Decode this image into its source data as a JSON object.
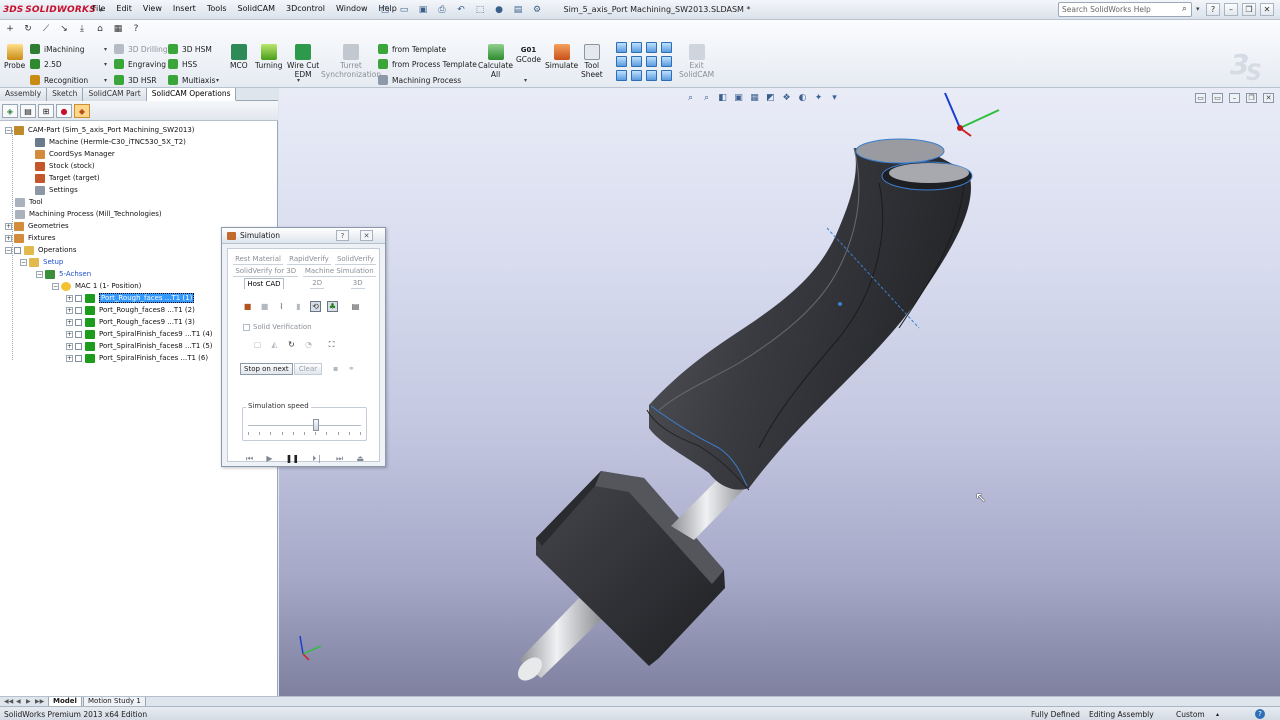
{
  "app": {
    "logo": "SOLIDWORKS",
    "title": "Sim_5_axis_Port Machining_SW2013.SLDASM *"
  },
  "menus": [
    "File",
    "Edit",
    "View",
    "Insert",
    "Tools",
    "SolidCAM",
    "3Dcontrol",
    "Window",
    "Help"
  ],
  "help_search": {
    "placeholder": "Search SolidWorks Help"
  },
  "commands": {
    "probe": "Probe",
    "imachining": "iMachining",
    "drilling_3d": "3D Drilling",
    "hsm_3d": "3D HSM",
    "d25": "2.5D",
    "engraving": "Engraving",
    "hss": "HSS",
    "recognition": "Recognition",
    "hsr_3d": "3D HSR",
    "multiaxis": "Multiaxis",
    "mco": "MCO",
    "turning": "Turning",
    "wire_edm": [
      "Wire Cut",
      "EDM"
    ],
    "turret_sync": [
      "Turret",
      "Synchronization"
    ],
    "from_template": "from Template",
    "from_process_template": "from Process Template",
    "machining_process": "Machining Process",
    "calculate_all": [
      "Calculate",
      "All"
    ],
    "gcode_top": "G01",
    "gcode": "GCode",
    "simulate": "Simulate",
    "tool_sheet": [
      "Tool",
      "Sheet"
    ],
    "exit_solidcam": [
      "Exit",
      "SolidCAM"
    ]
  },
  "tabs": [
    {
      "label": "Assembly",
      "active": false
    },
    {
      "label": "Sketch",
      "active": false
    },
    {
      "label": "SolidCAM Part",
      "active": false
    },
    {
      "label": "SolidCAM Operations",
      "active": true
    }
  ],
  "tree": {
    "root": "CAM-Part (Sim_5_axis_Port Machining_SW2013)",
    "machine": "Machine (Hermle-C30_iTNC530_5X_T2)",
    "coordsys": "CoordSys Manager",
    "stock": "Stock (stock)",
    "target": "Target (target)",
    "settings": "Settings",
    "tool": "Tool",
    "machining_process": "Machining Process (Mill_Technologies)",
    "geometries": "Geometries",
    "fixtures": "Fixtures",
    "operations": "Operations",
    "setup": "Setup",
    "achsen": "5-Achsen",
    "mac": "MAC 1 (1- Position)",
    "ops": [
      "Port_Rough_faces ...T1 (1)",
      "Port_Rough_faces8 ...T1 (2)",
      "Port_Rough_faces9 ...T1 (3)",
      "Port_SpiralFinish_faces9 ...T1 (4)",
      "Port_SpiralFinish_faces8 ...T1 (5)",
      "Port_SpiralFinish_faces ...T1 (6)"
    ]
  },
  "simulation": {
    "title": "Simulation",
    "tabs_row1": [
      "Rest Material",
      "RapidVerify",
      "SolidVerify"
    ],
    "tabs_row2": [
      "SolidVerify for 3D",
      "Machine Simulation"
    ],
    "tabs_row3": [
      "Host CAD",
      "2D",
      "3D"
    ],
    "solid_verification": "Solid Verification",
    "stop_on_next": "Stop on next",
    "clear": "Clear",
    "speed_label": "Simulation speed",
    "speed_value": 0.6
  },
  "bottom_tabs": [
    "Model",
    "Motion Study 1"
  ],
  "status": {
    "edition": "SolidWorks Premium 2013 x64 Edition",
    "defined": "Fully Defined",
    "mode": "Editing Assembly",
    "units": "Custom"
  },
  "colors": {
    "accent": "#3399ff",
    "logo_red": "#c8102e",
    "operation_green": "#1c9b1c",
    "model_dark": "#3c3d42"
  }
}
